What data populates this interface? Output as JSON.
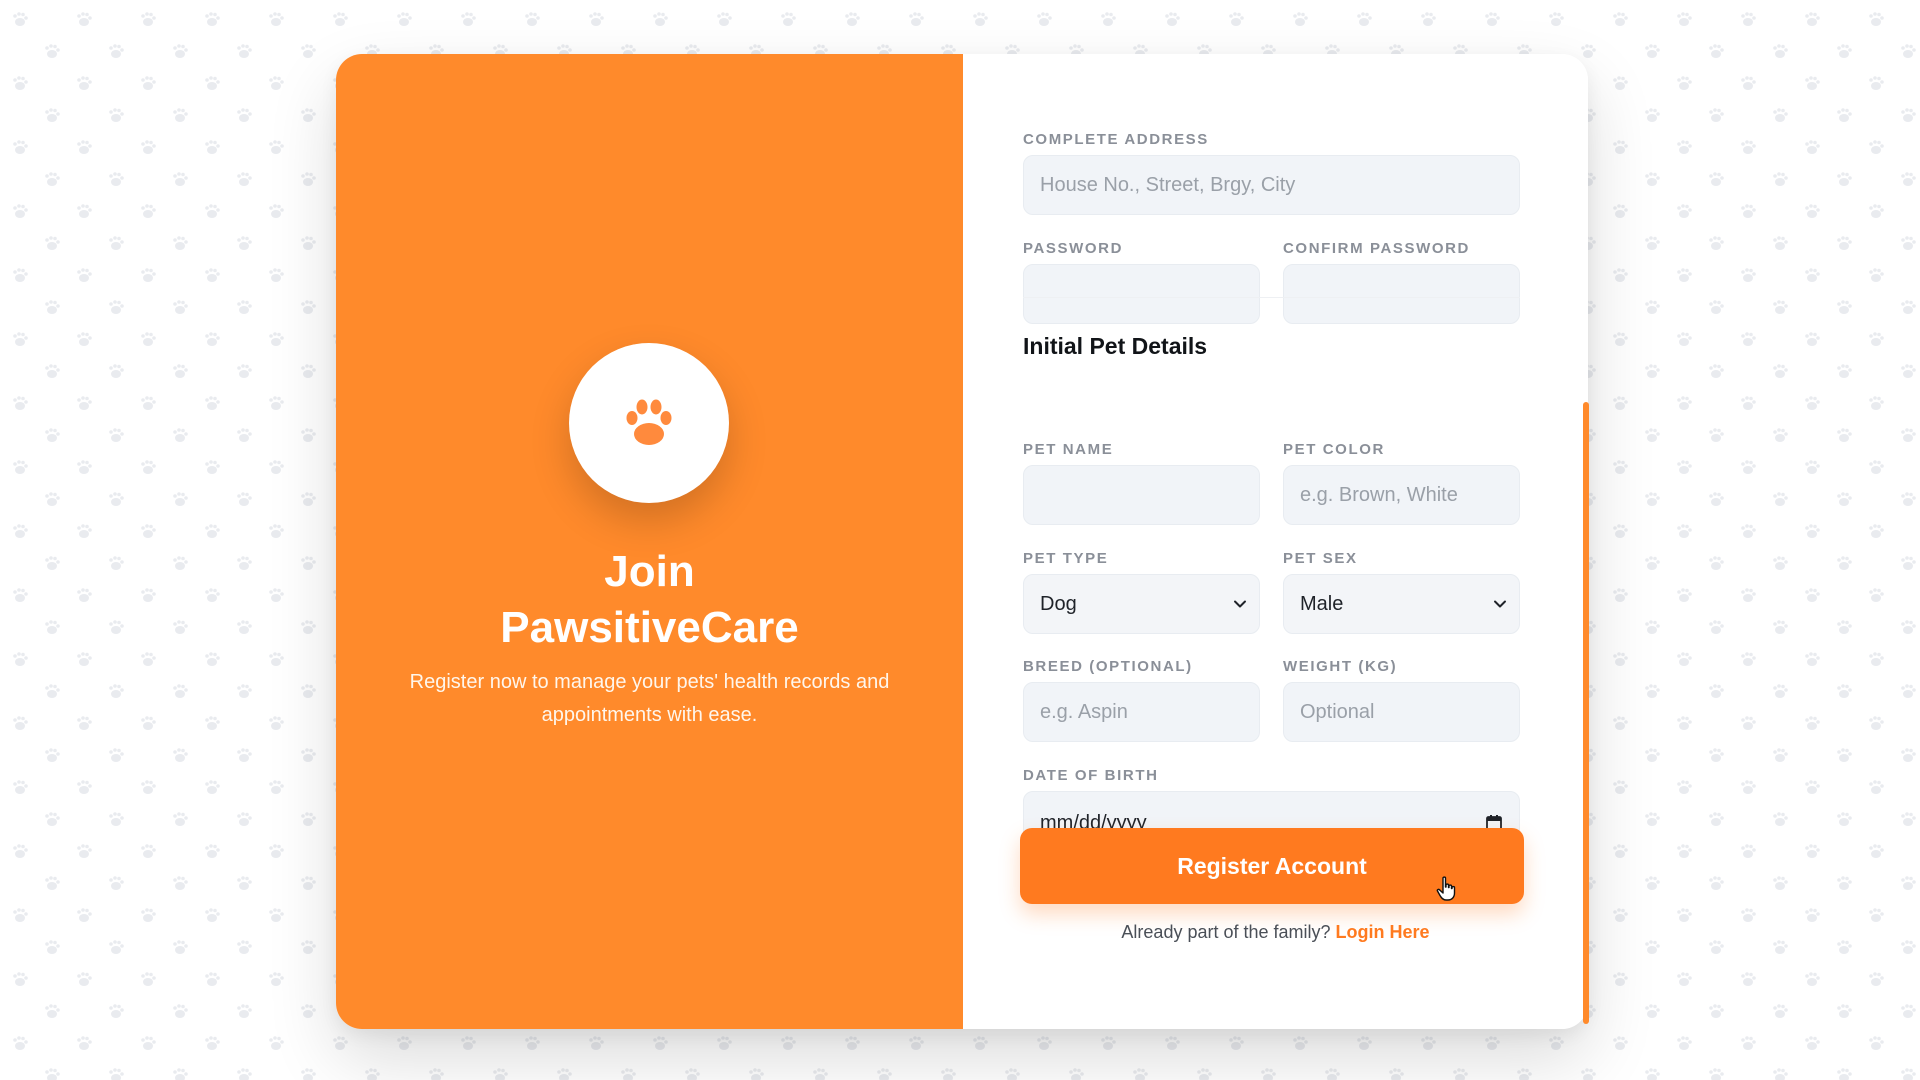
{
  "branding": {
    "title_line1": "Join",
    "title_line2": "PawsitiveCare",
    "subtitle": "Register now to manage your pets' health records and appointments with ease.",
    "logo_icon": "paw-icon"
  },
  "account": {
    "address_label": "COMPLETE ADDRESS",
    "address_placeholder": "House No., Street, Brgy, City",
    "password_label": "PASSWORD",
    "confirm_password_label": "CONFIRM PASSWORD"
  },
  "pet": {
    "section_title": "Initial Pet Details",
    "name_label": "PET NAME",
    "color_label": "PET COLOR",
    "color_placeholder": "e.g. Brown, White",
    "type_label": "PET TYPE",
    "type_value": "Dog",
    "sex_label": "PET SEX",
    "sex_value": "Male",
    "breed_label": "BREED (OPTIONAL)",
    "breed_placeholder": "e.g. Aspin",
    "weight_label": "WEIGHT (KG)",
    "weight_placeholder": "Optional",
    "dob_label": "DATE OF BIRTH",
    "dob_placeholder": "mm/dd/yyyy"
  },
  "actions": {
    "register_label": "Register Account",
    "footer_text": "Already part of the family?",
    "login_link": "Login Here"
  },
  "colors": {
    "brand_orange": "#ff8a2b",
    "button_orange": "#ff7a1f",
    "field_bg": "#f1f4f8"
  }
}
